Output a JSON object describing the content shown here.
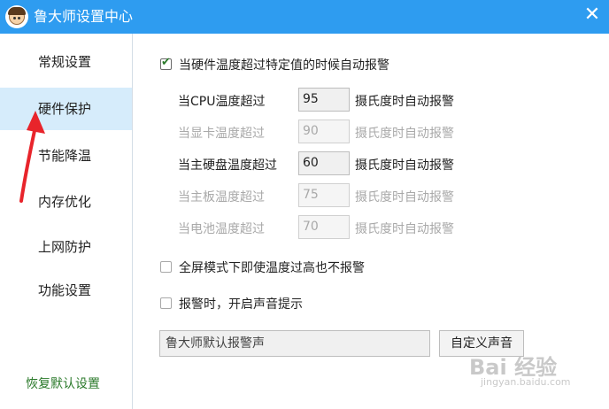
{
  "window": {
    "title": "鲁大师设置中心",
    "close_glyph": "✕",
    "accent": "#2e9cf0"
  },
  "sidebar": {
    "items": [
      {
        "label": "常规设置",
        "active": false
      },
      {
        "label": "硬件保护",
        "active": true
      },
      {
        "label": "节能降温",
        "active": false
      },
      {
        "label": "内存优化",
        "active": false
      },
      {
        "label": "上网防护",
        "active": false
      },
      {
        "label": "功能设置",
        "active": false
      }
    ],
    "restore_label": "恢复默认设置"
  },
  "main": {
    "auto_alarm": {
      "label": "当硬件温度超过特定值的时候自动报警",
      "checked": true
    },
    "thresholds": [
      {
        "label": "当CPU温度超过",
        "value": "95",
        "suffix": "摄氏度时自动报警",
        "enabled": true
      },
      {
        "label": "当显卡温度超过",
        "value": "90",
        "suffix": "摄氏度时自动报警",
        "enabled": false
      },
      {
        "label": "当主硬盘温度超过",
        "value": "60",
        "suffix": "摄氏度时自动报警",
        "enabled": true
      },
      {
        "label": "当主板温度超过",
        "value": "75",
        "suffix": "摄氏度时自动报警",
        "enabled": false
      },
      {
        "label": "当电池温度超过",
        "value": "70",
        "suffix": "摄氏度时自动报警",
        "enabled": false
      }
    ],
    "fullscreen_option": {
      "label": "全屏模式下即使温度过高也不报警",
      "checked": false
    },
    "sound_option": {
      "label": "报警时，开启声音提示",
      "checked": false
    },
    "sound_field": "鲁大师默认报警声",
    "custom_sound_button": "自定义声音"
  },
  "watermark": {
    "text": "Bai 经验",
    "subtext": "jingyan.baidu.com"
  }
}
